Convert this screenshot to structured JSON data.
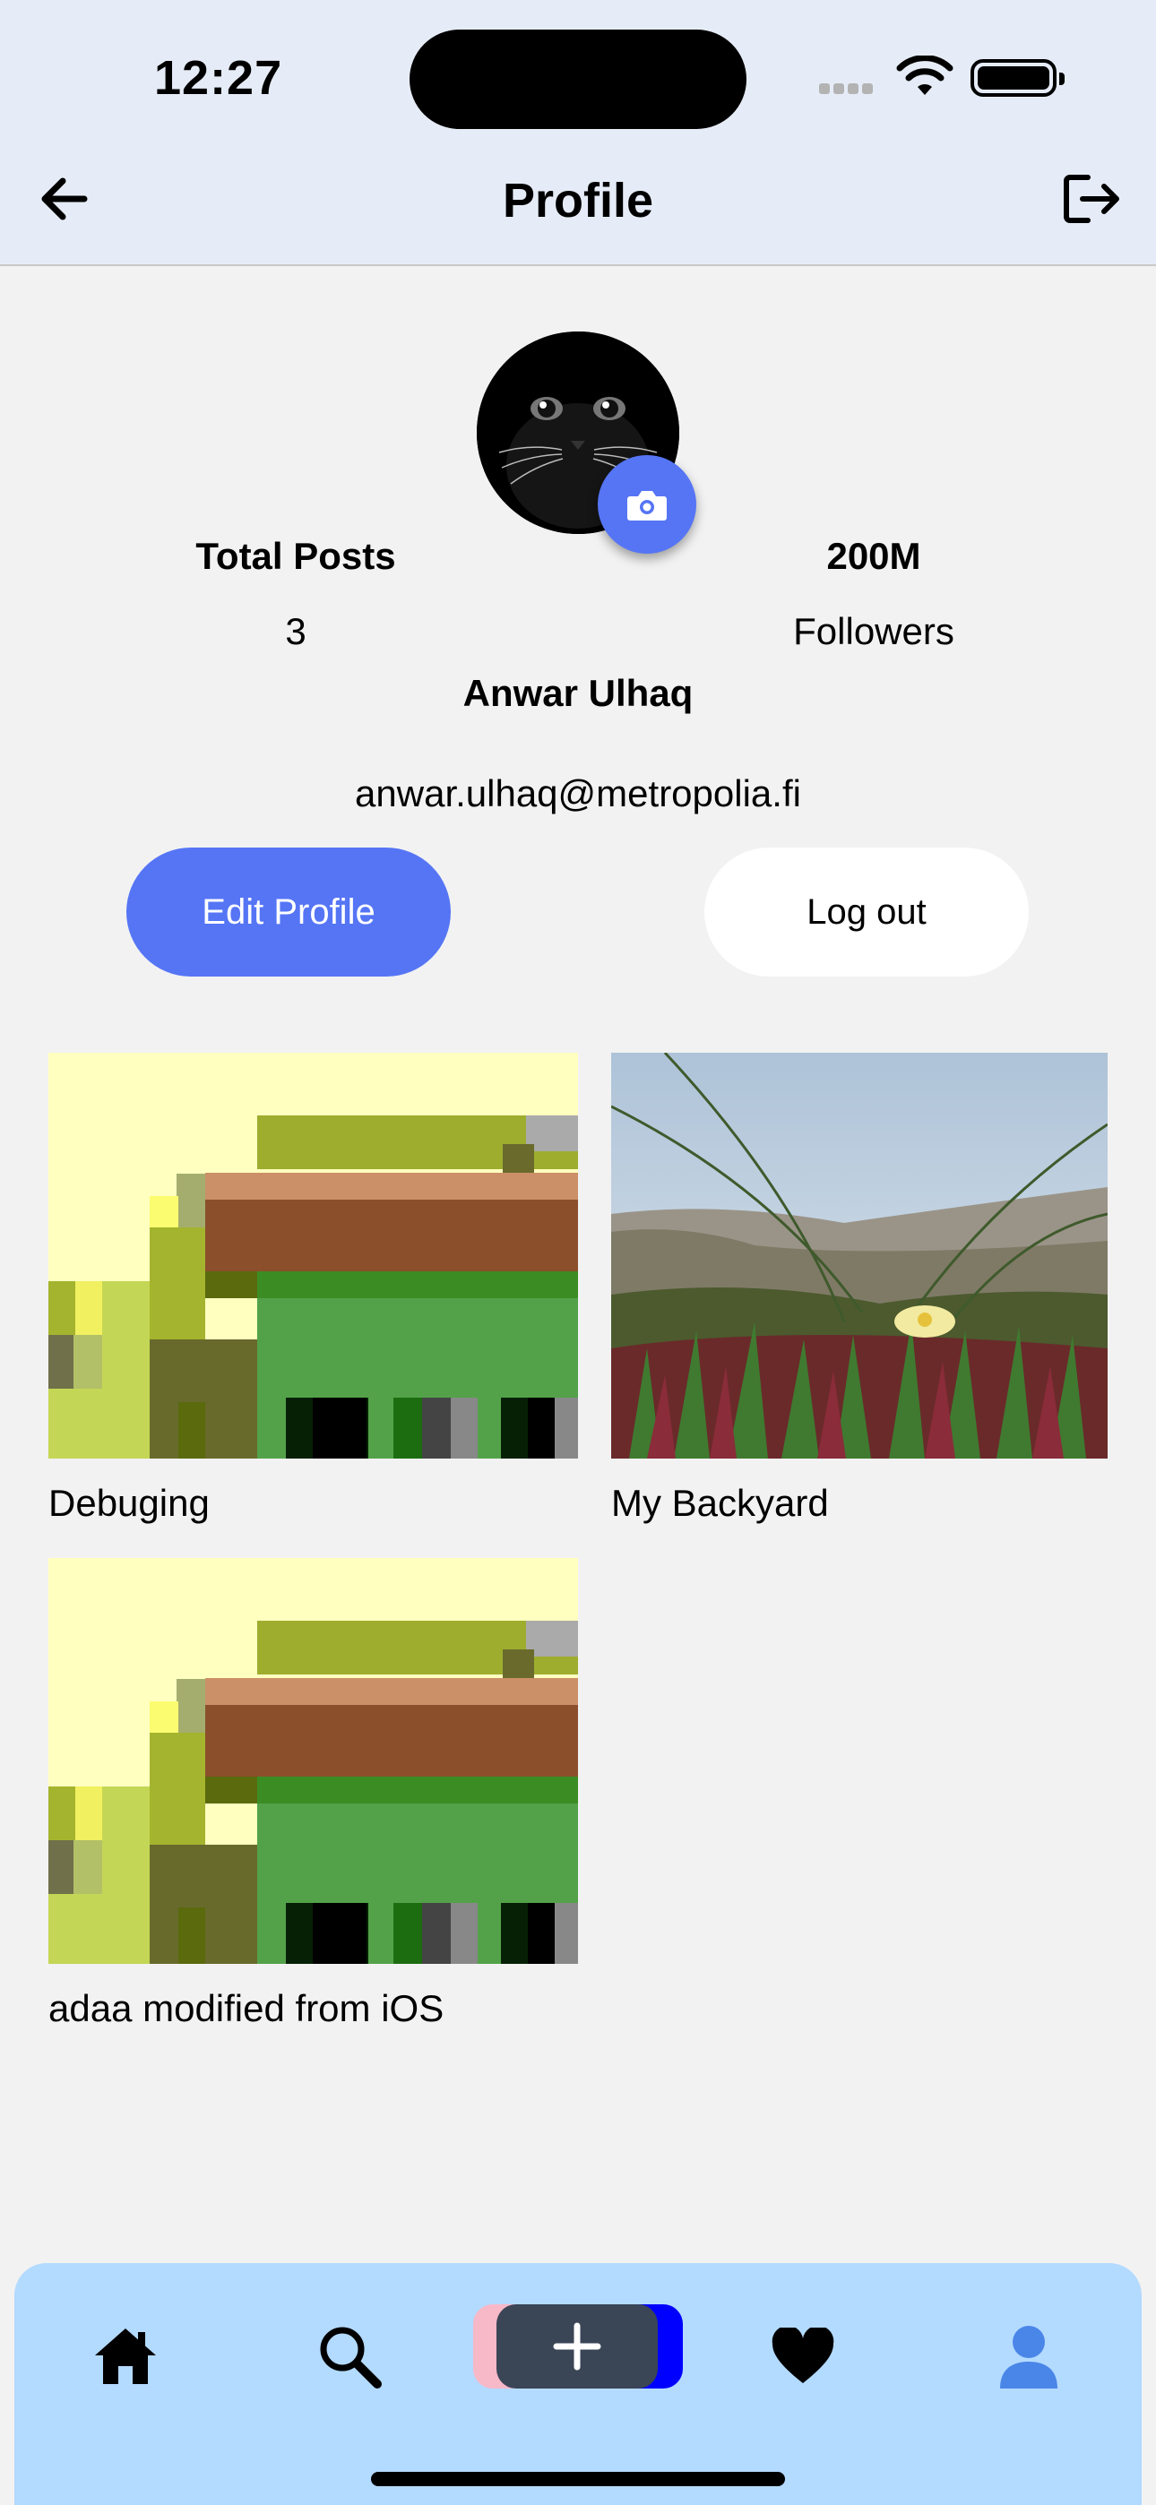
{
  "status_bar": {
    "time": "12:27"
  },
  "header": {
    "title": "Profile",
    "back_icon": "arrow-left-icon",
    "logout_icon": "exit-icon"
  },
  "profile": {
    "total_posts_label": "Total Posts",
    "total_posts_value": "3",
    "followers_value": "200M",
    "followers_label": "Followers",
    "name": "Anwar Ulhaq",
    "email": "anwar.ulhaq@metropolia.fi",
    "edit_label": "Edit Profile",
    "logout_label": "Log out",
    "accent_color": "#5575f5"
  },
  "posts": [
    {
      "caption": "Debuging"
    },
    {
      "caption": "My Backyard"
    },
    {
      "caption": "adaa modified from iOS"
    }
  ],
  "tabbar": {
    "items": [
      "home-icon",
      "search-icon",
      "add-icon",
      "heart-icon",
      "profile-icon"
    ],
    "active": "profile-icon"
  }
}
